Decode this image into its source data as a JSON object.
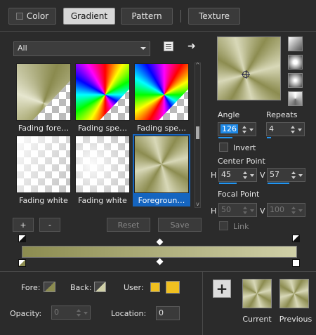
{
  "tabs": [
    {
      "label": "Color"
    },
    {
      "label": "Gradient"
    },
    {
      "label": "Pattern"
    },
    {
      "label": "Texture"
    }
  ],
  "category": {
    "selected": "All"
  },
  "thumbnails": [
    {
      "caption": "Fading fore…"
    },
    {
      "caption": "Fading spe…"
    },
    {
      "caption": "Fading spe…"
    },
    {
      "caption": "Fading white"
    },
    {
      "caption": "Fading white"
    },
    {
      "caption": "Foregroun…"
    }
  ],
  "buttons": {
    "add": "+",
    "remove": "-",
    "reset": "Reset",
    "save": "Save"
  },
  "angle": {
    "label": "Angle",
    "value": "126"
  },
  "repeats": {
    "label": "Repeats",
    "value": "4"
  },
  "invert": {
    "label": "Invert"
  },
  "center_point": {
    "label": "Center Point",
    "h_label": "H",
    "h": "45",
    "v_label": "V",
    "v": "57"
  },
  "focal_point": {
    "label": "Focal Point",
    "h_label": "H",
    "h": "50",
    "v_label": "V",
    "v": "100"
  },
  "link": {
    "label": "Link"
  },
  "fore": {
    "label": "Fore:"
  },
  "back": {
    "label": "Back:"
  },
  "user": {
    "label": "User:"
  },
  "opacity": {
    "label": "Opacity:",
    "value": "0"
  },
  "location": {
    "label": "Location:",
    "value": "0"
  },
  "current": {
    "label": "Current"
  },
  "previous": {
    "label": "Previous"
  },
  "colors": {
    "olive_dark": "#8c8c50",
    "olive_light": "#d0d0a8",
    "user_yellow": "#f0c020",
    "selection_blue": "#1565c0"
  }
}
